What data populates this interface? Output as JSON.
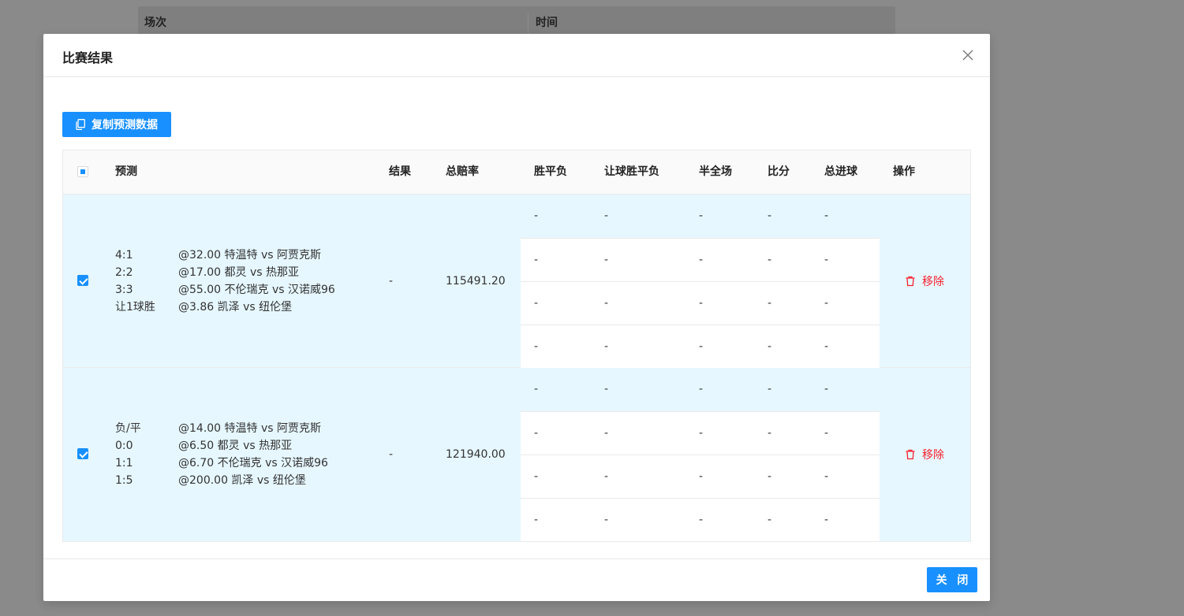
{
  "background": {
    "columns": [
      "场次",
      "时间"
    ]
  },
  "modal": {
    "title": "比赛结果",
    "copy_button": "复制预测数据",
    "close_button": "关 闭"
  },
  "table": {
    "headers": {
      "prediction": "预测",
      "result": "结果",
      "total_odds": "总赔率",
      "win_draw_lose": "胜平负",
      "handicap": "让球胜平负",
      "half_full": "半全场",
      "score": "比分",
      "total_goals": "总进球",
      "action": "操作"
    },
    "rows": [
      {
        "checked": true,
        "predictions": [
          {
            "pick": "4:1",
            "detail": "@32.00 特温特 vs 阿贾克斯"
          },
          {
            "pick": "2:2",
            "detail": "@17.00 都灵 vs 热那亚"
          },
          {
            "pick": "3:3",
            "detail": "@55.00 不伦瑞克 vs 汉诺威96"
          },
          {
            "pick": "让1球胜",
            "detail": "@3.86 凯泽 vs 纽伦堡"
          }
        ],
        "result": "-",
        "total_odds": "115491.20",
        "sub_results": [
          [
            "-",
            "-",
            "-",
            "-",
            "-"
          ],
          [
            "-",
            "-",
            "-",
            "-",
            "-"
          ],
          [
            "-",
            "-",
            "-",
            "-",
            "-"
          ],
          [
            "-",
            "-",
            "-",
            "-",
            "-"
          ]
        ],
        "action": "移除"
      },
      {
        "checked": true,
        "predictions": [
          {
            "pick": "负/平",
            "detail": "@14.00 特温特 vs 阿贾克斯"
          },
          {
            "pick": "0:0",
            "detail": "@6.50 都灵 vs 热那亚"
          },
          {
            "pick": "1:1",
            "detail": "@6.70 不伦瑞克 vs 汉诺威96"
          },
          {
            "pick": "1:5",
            "detail": "@200.00 凯泽 vs 纽伦堡"
          }
        ],
        "result": "-",
        "total_odds": "121940.00",
        "sub_results": [
          [
            "-",
            "-",
            "-",
            "-",
            "-"
          ],
          [
            "-",
            "-",
            "-",
            "-",
            "-"
          ],
          [
            "-",
            "-",
            "-",
            "-",
            "-"
          ],
          [
            "-",
            "-",
            "-",
            "-",
            "-"
          ]
        ],
        "action": "移除"
      }
    ]
  },
  "colors": {
    "primary": "#1890ff",
    "danger": "#f5222d",
    "selected_row": "#e6f7ff"
  }
}
